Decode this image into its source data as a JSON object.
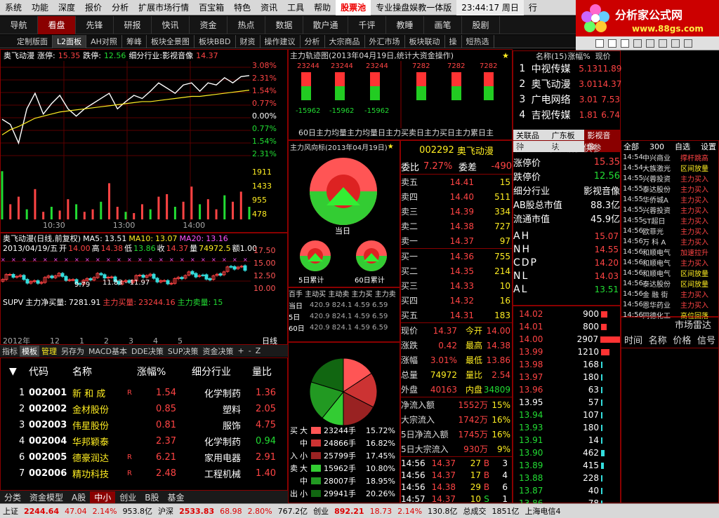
{
  "menu": {
    "items": [
      "系统",
      "功能",
      "深度",
      "报价",
      "分析",
      "扩展市场行情",
      "百宝箱",
      "特色",
      "资讯",
      "工具",
      "帮助"
    ],
    "highlight": "股票池",
    "title": "专业操盘娱教一体版",
    "time": "23:44:17 周日",
    "extra": "行"
  },
  "nav": {
    "items": [
      "导航",
      "看盘",
      "先锋",
      "研报",
      "快讯",
      "资金",
      "热点",
      "数据",
      "散户通",
      "千评",
      "教睡",
      "画笔",
      "股剧"
    ],
    "active": 1
  },
  "tabs": {
    "items": [
      "定制版面",
      "L2面板",
      "AH对照",
      "筹峰",
      "板块全景图",
      "板块BBD",
      "财资",
      "操作建议",
      "分析",
      "大宗商品",
      "外汇市场",
      "板块联动",
      "操",
      "短热选"
    ],
    "active": 1
  },
  "logo": {
    "title": "分析家公式网",
    "url": "www.88gs.com"
  },
  "intraday": {
    "name": "奥飞动漫",
    "zhangting_label": "涨停:",
    "zhangting": "15.35",
    "dieting_label": "跌停:",
    "dieting": "12.56",
    "industry": "细分行业:影视音像",
    "price": "14.37",
    "right_pct": [
      "3.08%",
      "2.31%",
      "1.54%",
      "0.77%",
      "0.00%",
      "0.77%",
      "1.54%",
      "2.31%"
    ],
    "left_prices": [],
    "vol_labels": [
      "1911",
      "1433",
      "955",
      "478"
    ],
    "time_labels": [
      "10:30",
      "13:00",
      "14:00"
    ],
    "price_series": [
      13.95,
      13.9,
      13.72,
      14.05,
      14.2,
      14.0,
      14.1,
      14.18,
      14.05,
      13.98,
      14.05,
      14.1,
      14.15,
      14.2,
      14.05,
      14.12,
      14.18,
      14.15,
      14.22,
      14.3,
      14.25,
      14.2,
      14.28,
      14.3,
      14.22,
      14.3,
      14.28,
      14.35,
      14.3,
      14.36,
      14.37
    ],
    "avg_series": [
      13.8,
      13.85,
      13.88,
      13.92,
      13.96,
      13.98,
      14.0,
      14.02,
      14.03,
      14.04,
      14.05,
      14.06,
      14.07,
      14.08,
      14.09,
      14.1,
      14.11,
      14.12,
      14.12,
      14.13,
      14.14,
      14.15,
      14.16,
      14.17,
      14.17,
      14.18,
      14.19,
      14.2,
      14.21,
      14.22,
      14.23
    ],
    "volumes": [
      1911,
      600,
      900,
      400,
      1200,
      300,
      500,
      350,
      800,
      600,
      300,
      400,
      700,
      1433,
      500,
      300,
      250,
      600,
      400,
      900,
      1000,
      500,
      700,
      1300,
      600,
      800,
      400,
      955,
      700,
      1100,
      500
    ]
  },
  "kline": {
    "title": "奥飞动漫(日线,前复权)",
    "ma5_label": "MA5:",
    "ma5": "13.51",
    "ma10_label": "MA10:",
    "ma10": "13.07",
    "ma20_label": "MA20:",
    "ma20": "13.16",
    "date": "2013/04/19/五",
    "open_label": "开",
    "open": "14.00",
    "high_label": "高",
    "high": "14.38",
    "low_label": "低",
    "low": "13.86",
    "close_label": "收",
    "close": "14.37",
    "vol_label": "量",
    "vol": "74972.5",
    "amt": "额1.00",
    "price_labels": [
      "17.50",
      "15.00",
      "12.50",
      "10.00"
    ],
    "low_mark": "9.79",
    "range": "11.83 - 11.97",
    "supv_label": "SUPV",
    "net_label": "主力净买量:",
    "net": "7281.91",
    "buy_label": "主力买量:",
    "buy": "23244.16",
    "sell_label": "主力卖量:",
    "sell": "15",
    "axis": [
      "2012年",
      "12",
      "1",
      "2",
      "3",
      "4",
      "5"
    ],
    "freq": "日线"
  },
  "bottom_tabs": [
    "指标",
    "模板",
    "管理",
    "另存为",
    "MACD基本",
    "DDE决策",
    "SUP决策",
    "资金决策",
    "+",
    "-",
    "Z"
  ],
  "stock_list": {
    "headers": [
      "代码",
      "名称",
      "涨幅%",
      "细分行业",
      "量比"
    ],
    "rows": [
      {
        "no": "1",
        "code": "002001",
        "name": "新 和 成",
        "flag": "R",
        "pct": "1.54",
        "ind": "化学制药",
        "lb": "1.36"
      },
      {
        "no": "2",
        "code": "002002",
        "name": "金材股份",
        "flag": "",
        "pct": "0.85",
        "ind": "塑料",
        "lb": "2.05"
      },
      {
        "no": "3",
        "code": "002003",
        "name": "伟星股份",
        "flag": "",
        "pct": "0.81",
        "ind": "服饰",
        "lb": "4.75"
      },
      {
        "no": "4",
        "code": "002004",
        "name": "华邦颖泰",
        "flag": "",
        "pct": "2.37",
        "ind": "化学制药",
        "lb": "0.94"
      },
      {
        "no": "6",
        "code": "002005",
        "name": "德豪润达",
        "flag": "R",
        "pct": "6.21",
        "ind": "家用电器",
        "lb": "2.91"
      },
      {
        "no": "7",
        "code": "002006",
        "name": "精功科技",
        "flag": "R",
        "pct": "2.48",
        "ind": "工程机械",
        "lb": "1.40"
      }
    ]
  },
  "list_tabs": [
    "分类",
    "资金模型",
    "A股",
    "中小",
    "创业",
    "B股",
    "基金"
  ],
  "track": {
    "title": "主力轨迹图(2013年04月19日,统计大资金操作)",
    "top": [
      "23244",
      "23244",
      "23244",
      "7282",
      "7282",
      "7282"
    ],
    "bot": [
      "-15962",
      "-15962",
      "-15962"
    ],
    "labels": "60日主力均量主力均量日主力买卖日主力买日主力累日主"
  },
  "vane": {
    "title": "主力风向标(2013年04月19日)",
    "today": "当日",
    "d5": "5日累计",
    "d60": "60日累计"
  },
  "flow_hdr": "百手  主动买  主动卖  主力买  主力卖",
  "flow_rows": [
    {
      "k": "当日",
      "v": "420.9  824.1  4.59  6.59"
    },
    {
      "k": "5日",
      "v": "420.9  824.1  4.59  6.59"
    },
    {
      "k": "60日",
      "v": "420.9  824.1  4.59  6.59"
    }
  ],
  "orderbook": {
    "code": "002292",
    "name": "奥飞动漫",
    "wb_label": "委比",
    "wb": "7.27%",
    "wc_label": "委差",
    "wc": "-490",
    "sells": [
      {
        "k": "卖五",
        "p": "14.41",
        "v": "15"
      },
      {
        "k": "卖四",
        "p": "14.40",
        "v": "511"
      },
      {
        "k": "卖三",
        "p": "14.39",
        "v": "334"
      },
      {
        "k": "卖二",
        "p": "14.38",
        "v": "727"
      },
      {
        "k": "卖一",
        "p": "14.37",
        "v": "97"
      }
    ],
    "buys": [
      {
        "k": "买一",
        "p": "14.36",
        "v": "755"
      },
      {
        "k": "买二",
        "p": "14.35",
        "v": "214"
      },
      {
        "k": "买三",
        "p": "14.33",
        "v": "10"
      },
      {
        "k": "买四",
        "p": "14.32",
        "v": "16"
      },
      {
        "k": "买五",
        "p": "14.31",
        "v": "183"
      }
    ],
    "quote": [
      {
        "a": "现价",
        "b": "14.37",
        "c": "今开",
        "d": "14.00"
      },
      {
        "a": "涨跌",
        "b": "0.42",
        "c": "最高",
        "d": "14.38"
      },
      {
        "a": "涨幅",
        "b": "3.01%",
        "c": "最低",
        "d": "13.86"
      },
      {
        "a": "总量",
        "b": "74972",
        "c": "量比",
        "d": "2.54"
      },
      {
        "a": "外盘",
        "b": "40163",
        "c": "内盘",
        "d": "34809"
      }
    ],
    "flows": [
      {
        "a": "净流入额",
        "b": "1552万",
        "c": "15%"
      },
      {
        "a": "大宗流入",
        "b": "1742万",
        "c": "16%"
      },
      {
        "a": "5日净流入额",
        "b": "1745万",
        "c": "16%"
      },
      {
        "a": "5日大宗流入",
        "b": "930万",
        "c": "9%"
      }
    ],
    "ticks": [
      {
        "t": "14:56",
        "p": "14.37",
        "v": "27",
        "f": "B",
        "n": "3"
      },
      {
        "t": "14:56",
        "p": "14.37",
        "v": "17",
        "f": "B",
        "n": "4"
      },
      {
        "t": "14:56",
        "p": "14.38",
        "v": "29",
        "f": "B",
        "n": "6"
      },
      {
        "t": "14:57",
        "p": "14.37",
        "v": "10",
        "f": "S",
        "n": "1"
      },
      {
        "t": "15:00",
        "p": "14.37",
        "v": "1059",
        "f": "",
        "n": "8"
      }
    ]
  },
  "pie2": {
    "rows": [
      {
        "s": "买",
        "k": "大",
        "v": "23244手",
        "p": "15.72%"
      },
      {
        "s": "",
        "k": "中",
        "v": "24866手",
        "p": "16.82%"
      },
      {
        "s": "入",
        "k": "小",
        "v": "25799手",
        "p": "17.45%"
      },
      {
        "s": "卖",
        "k": "大",
        "v": "15962手",
        "p": "10.80%"
      },
      {
        "s": "",
        "k": "中",
        "v": "28007手",
        "p": "18.95%"
      },
      {
        "s": "出",
        "k": "小",
        "v": "29941手",
        "p": "20.26%"
      }
    ]
  },
  "sector": {
    "headers": [
      "名称(15)",
      "涨幅%",
      "现价"
    ],
    "rows": [
      {
        "no": "1",
        "n": "中视传媒",
        "p": "5.13",
        "v": "11.89"
      },
      {
        "no": "2",
        "n": "奥飞动漫",
        "p": "3.01",
        "v": "14.37"
      },
      {
        "no": "3",
        "n": "广电网络",
        "p": "3.01",
        "v": "7.53"
      },
      {
        "no": "4",
        "n": "吉视传媒",
        "p": "1.81",
        "v": "6.74"
      }
    ],
    "tabs": [
      "关联品种",
      "广东板块",
      "影视音像"
    ]
  },
  "info": {
    "tip": "提示: 以下数据仅供参",
    "rows": [
      {
        "k": "涨停价",
        "v": "15.35"
      },
      {
        "k": "跌停价",
        "v": "12.56"
      },
      {
        "k": "细分行业",
        "v": "影视音像"
      },
      {
        "k": "AB股总市值",
        "v": "88.3亿"
      },
      {
        "k": "流通市值",
        "v": "45.9亿"
      }
    ],
    "idx": [
      {
        "k": "AH",
        "v": "15.07"
      },
      {
        "k": "NH",
        "v": "14.55"
      },
      {
        "k": "CDP",
        "v": "14.20"
      },
      {
        "k": "NL",
        "v": "14.03"
      },
      {
        "k": "AL",
        "v": "13.51"
      }
    ]
  },
  "bids": [
    {
      "p": "14.02",
      "v": "900"
    },
    {
      "p": "14.01",
      "v": "800"
    },
    {
      "p": "14.00",
      "v": "2907"
    },
    {
      "p": "13.99",
      "v": "1210"
    },
    {
      "p": "13.98",
      "v": "168"
    },
    {
      "p": "13.97",
      "v": "180"
    },
    {
      "p": "13.96",
      "v": "63"
    },
    {
      "p": "13.95",
      "v": "57"
    },
    {
      "p": "13.94",
      "v": "107"
    },
    {
      "p": "13.93",
      "v": "180"
    },
    {
      "p": "13.91",
      "v": "14"
    },
    {
      "p": "13.90",
      "v": "462"
    },
    {
      "p": "13.89",
      "v": "415"
    },
    {
      "p": "13.88",
      "v": "228"
    },
    {
      "p": "13.87",
      "v": "40"
    },
    {
      "p": "13.86",
      "v": "78"
    }
  ],
  "news": {
    "tabs": [
      "全部",
      "300",
      "自选",
      "设置"
    ],
    "rows": [
      {
        "t": "14:54",
        "n": "中兴商业",
        "a": "撑杆跳高"
      },
      {
        "t": "14:54",
        "n": "大族激光",
        "a": "区间放量"
      },
      {
        "t": "14:55",
        "n": "兴蓉投资",
        "a": "主力买入"
      },
      {
        "t": "14:55",
        "n": "泰达股份",
        "a": "主力买入"
      },
      {
        "t": "14:55",
        "n": "华侨城A",
        "a": "主力买入"
      },
      {
        "t": "14:55",
        "n": "兴蓉投资",
        "a": "主力买入"
      },
      {
        "t": "14:55",
        "n": "ST超日",
        "a": "主力买入"
      },
      {
        "t": "14:56",
        "n": "欧菲光",
        "a": "主力买入"
      },
      {
        "t": "14:56",
        "n": "万 科 A",
        "a": "主力买入"
      },
      {
        "t": "14:56",
        "n": "和顺电气",
        "a": "加速拉升"
      },
      {
        "t": "14:56",
        "n": "和顺电气",
        "a": "主力买入"
      },
      {
        "t": "14:56",
        "n": "和顺电气",
        "a": "区间放量"
      },
      {
        "t": "14:56",
        "n": "泰达股份",
        "a": "区间放量"
      },
      {
        "t": "14:56",
        "n": "金 融 街",
        "a": "主力买入"
      },
      {
        "t": "14:56",
        "n": "恩华药业",
        "a": "主力买入"
      },
      {
        "t": "14:56",
        "n": "同德化工",
        "a": "高位回落"
      }
    ],
    "radar": "市场雷达",
    "rhdr": [
      "时间",
      "名称",
      "价格",
      "信号"
    ]
  },
  "status": {
    "sh_label": "上证",
    "sh": "2244.64",
    "sh_chg": "47.04",
    "sh_pct": "2.14%",
    "sh_amt": "953.8亿",
    "hs_label": "沪深",
    "hs": "2533.83",
    "hs_chg": "68.98",
    "hs_pct": "2.80%",
    "hs_amt": "767.2亿",
    "cy_label": "创业",
    "cy": "892.21",
    "cy_chg": "18.73",
    "cy_pct": "2.14%",
    "cy_amt": "130.8亿",
    "total_label": "总成交",
    "total": "1851亿",
    "server": "上海电信4"
  }
}
